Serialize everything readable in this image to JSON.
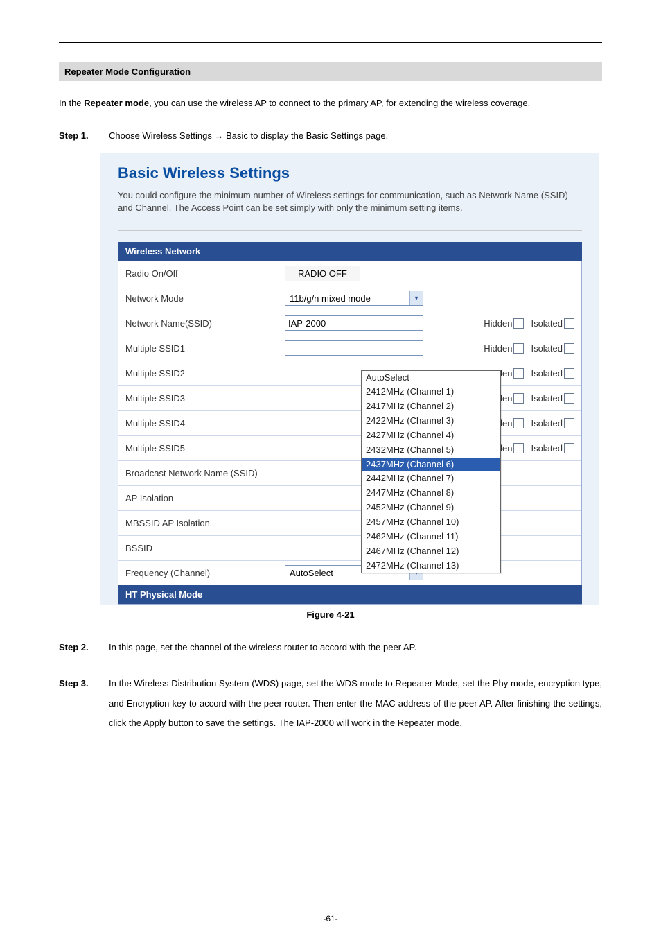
{
  "doc": {
    "section_title": "Repeater Mode Configuration",
    "intro_before_bold": "In the ",
    "intro_bold": "Repeater mode",
    "intro_after_bold": ", you can use the wireless AP to connect to the primary AP, for extending the wireless coverage.",
    "step1_label": "Step 1.",
    "step1_body_before": "Choose Wireless Settings ",
    "step1_arrow": "→",
    "step1_body_after": " Basic to display the Basic Settings page.",
    "fig_caption": "Figure 4-21",
    "step2_label": "Step 2.",
    "step2_body": "In this page, set the channel of the wireless router to accord with the peer AP.",
    "step3_label": "Step 3.",
    "step3_body": "In the Wireless Distribution System (WDS) page, set the WDS mode to Repeater Mode, set the Phy mode, encryption type, and Encryption key to accord with the peer router. Then enter the MAC address of the peer AP. After finishing the settings, click the Apply button to save the settings. The IAP-2000 will work in the Repeater mode.",
    "page_number": "-61-"
  },
  "figure": {
    "heading": "Basic Wireless Settings",
    "description": "You could configure the minimum number of Wireless settings for communication, such as Network Name (SSID) and Channel. The Access Point can be set simply with only the minimum setting items.",
    "wireless_network_header": "Wireless Network",
    "radio_row_label": "Radio On/Off",
    "radio_button_label": "RADIO OFF",
    "network_mode_label": "Network Mode",
    "network_mode_value": "11b/g/n mixed mode",
    "ssid_label": "Network Name(SSID)",
    "ssid_value": "IAP-2000",
    "hidden_label": "Hidden",
    "isolated_label": "Isolated",
    "multi_ssid1": "Multiple SSID1",
    "multi_ssid2": "Multiple SSID2",
    "multi_ssid3": "Multiple SSID3",
    "multi_ssid4": "Multiple SSID4",
    "multi_ssid5": "Multiple SSID5",
    "hidden_clip": "Hidden",
    "isolated_clip": "Isolated",
    "hidden_clip2": "lidden",
    "broadcast_label": "Broadcast Network Name (SSID)",
    "ap_isolation_label": "AP Isolation",
    "mbssid_label": "MBSSID AP Isolation",
    "bssid_label": "BSSID",
    "freq_label": "Frequency (Channel)",
    "freq_value": "AutoSelect",
    "ht_header": "HT Physical Mode",
    "dropdown_items": [
      {
        "label": "AutoSelect",
        "hi": false
      },
      {
        "label": "2412MHz (Channel 1)",
        "hi": false
      },
      {
        "label": "2417MHz (Channel 2)",
        "hi": false
      },
      {
        "label": "2422MHz (Channel 3)",
        "hi": false
      },
      {
        "label": "2427MHz (Channel 4)",
        "hi": false
      },
      {
        "label": "2432MHz (Channel 5)",
        "hi": false
      },
      {
        "label": "2437MHz (Channel 6)",
        "hi": true
      },
      {
        "label": "2442MHz (Channel 7)",
        "hi": false
      },
      {
        "label": "2447MHz (Channel 8)",
        "hi": false
      },
      {
        "label": "2452MHz (Channel 9)",
        "hi": false
      },
      {
        "label": "2457MHz (Channel 10)",
        "hi": false
      },
      {
        "label": "2462MHz (Channel 11)",
        "hi": false
      },
      {
        "label": "2467MHz (Channel 12)",
        "hi": false
      },
      {
        "label": "2472MHz (Channel 13)",
        "hi": false
      }
    ]
  }
}
